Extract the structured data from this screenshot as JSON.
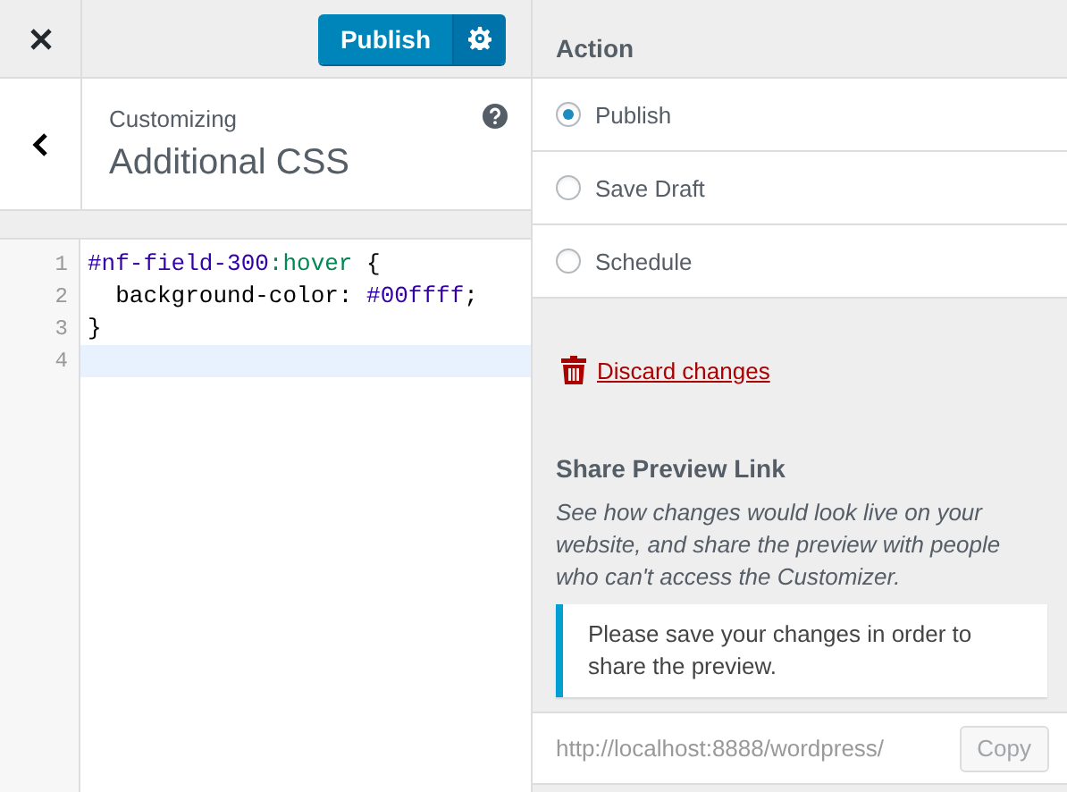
{
  "header": {
    "publish_button": "Publish"
  },
  "section": {
    "eyebrow": "Customizing",
    "title": "Additional CSS"
  },
  "editor": {
    "lines": [
      {
        "number": "1",
        "active": false,
        "tokens": [
          {
            "kind": "selector",
            "text": "#nf-field-300"
          },
          {
            "kind": "pseudo",
            "text": ":hover"
          },
          {
            "kind": "plain",
            "text": " {"
          }
        ]
      },
      {
        "number": "2",
        "active": false,
        "tokens": [
          {
            "kind": "plain",
            "text": "  background-color: "
          },
          {
            "kind": "value",
            "text": "#00ffff"
          },
          {
            "kind": "plain",
            "text": ";"
          }
        ]
      },
      {
        "number": "3",
        "active": false,
        "tokens": [
          {
            "kind": "plain",
            "text": "}"
          }
        ]
      },
      {
        "number": "4",
        "active": true
      }
    ]
  },
  "action": {
    "title": "Action",
    "options": [
      {
        "label": "Publish",
        "selected": true
      },
      {
        "label": "Save Draft",
        "selected": false
      },
      {
        "label": "Schedule",
        "selected": false
      }
    ]
  },
  "discard_link": "Discard changes",
  "share": {
    "title": "Share Preview Link",
    "description": "See how changes would look live on your website, and share the preview with people who can't access the Customizer.",
    "notice": "Please save your changes in order to share the preview.",
    "url": "http://localhost:8888/wordpress/",
    "copy_button": "Copy"
  }
}
